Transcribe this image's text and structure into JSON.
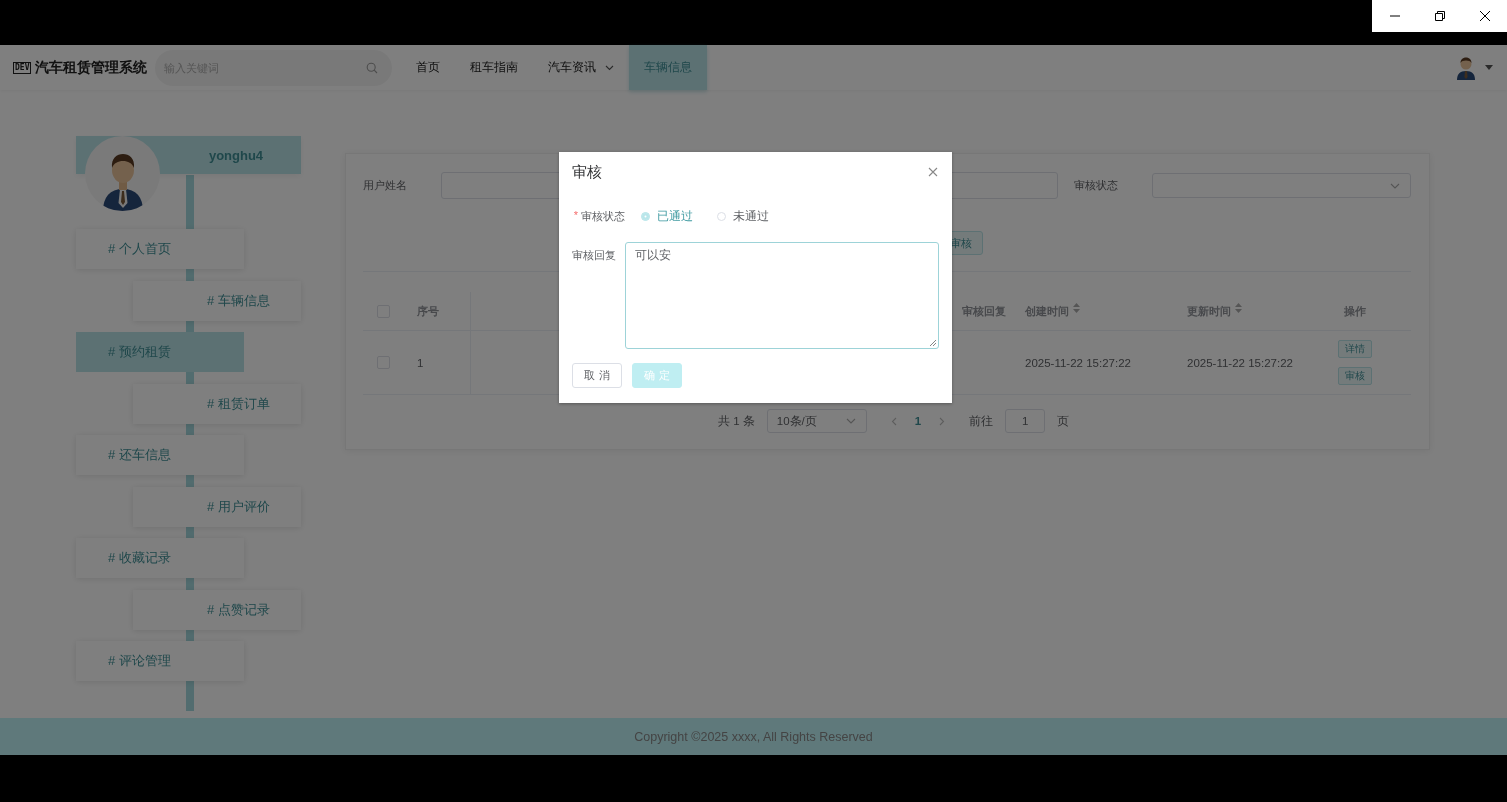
{
  "header": {
    "logo_badge": "DEV",
    "title": "汽车租赁管理系统",
    "search": {
      "placeholder": "输入关键词"
    },
    "nav": [
      {
        "label": "首页",
        "selected": false,
        "has_menu": false
      },
      {
        "label": "租车指南",
        "selected": false,
        "has_menu": false
      },
      {
        "label": "汽车资讯",
        "selected": false,
        "has_menu": true
      },
      {
        "label": "车辆信息",
        "selected": true,
        "has_menu": false
      }
    ]
  },
  "sidebar": {
    "username": "yonghu4",
    "items": [
      {
        "label": "# 个人首页",
        "selected": false
      },
      {
        "label": "# 车辆信息",
        "selected": false
      },
      {
        "label": "# 预约租赁",
        "selected": true
      },
      {
        "label": "# 租赁订单",
        "selected": false
      },
      {
        "label": "# 还车信息",
        "selected": false
      },
      {
        "label": "# 用户评价",
        "selected": false
      },
      {
        "label": "# 收藏记录",
        "selected": false
      },
      {
        "label": "# 点赞记录",
        "selected": false
      },
      {
        "label": "# 评论管理",
        "selected": false
      }
    ]
  },
  "filters": [
    {
      "label": "用户姓名",
      "kind": "input"
    },
    {
      "label": "审核状态",
      "kind": "select"
    }
  ],
  "actions": [
    "审核"
  ],
  "table": {
    "all_checked": false,
    "columns": [
      {
        "label": "序号",
        "sortable": false
      },
      {
        "label": "审核回复",
        "sortable": false
      },
      {
        "label": "创建时间",
        "sortable": true
      },
      {
        "label": "更新时间",
        "sortable": true
      },
      {
        "label": "操作",
        "sortable": false
      }
    ],
    "rows": [
      {
        "checked": false,
        "index": "1",
        "created_at": "2025-11-22 15:27:22",
        "updated_at": "2025-11-22 15:27:22",
        "actions": [
          "详情",
          "审核"
        ]
      }
    ]
  },
  "pagination": {
    "total": "共 1 条",
    "page_size": "10条/页",
    "pages": [
      {
        "label": "1",
        "selected": true
      }
    ],
    "goto_label": "前往",
    "goto_value": "1",
    "page_suffix": "页"
  },
  "dialog": {
    "title": "审核",
    "fields": [
      {
        "label": "审核状态",
        "required_mark": "*",
        "kind": "radio",
        "options": [
          {
            "label": "已通过",
            "selected": true
          },
          {
            "label": "未通过",
            "selected": false
          }
        ]
      },
      {
        "label": "审核回复",
        "kind": "textarea",
        "value": "可以安"
      }
    ],
    "buttons": [
      {
        "label": "取 消",
        "kind": "default",
        "disabled": false
      },
      {
        "label": "确 定",
        "kind": "primary",
        "disabled": true
      }
    ]
  },
  "footer": "Copyright ©2025 xxxx, All Rights Reserved"
}
